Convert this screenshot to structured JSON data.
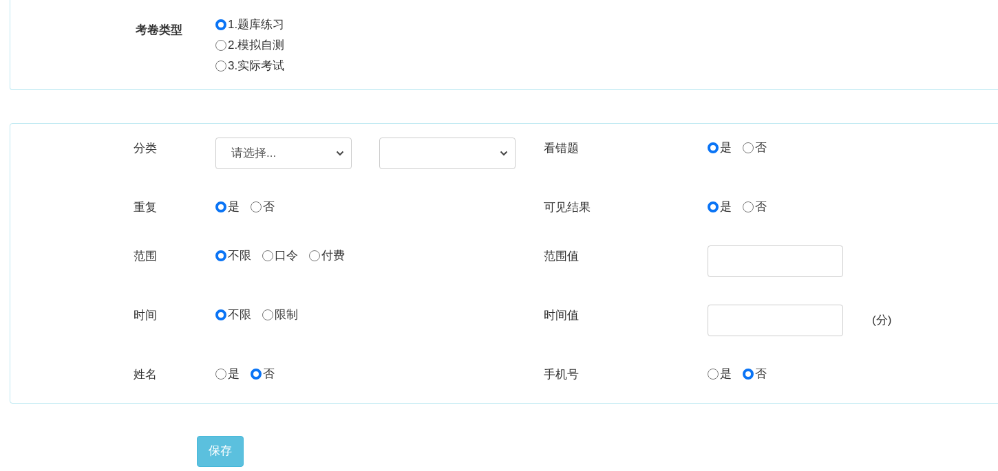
{
  "exam_type": {
    "label": "考卷类型",
    "options": [
      {
        "label": "1.题库练习",
        "selected": true
      },
      {
        "label": "2.模拟自测",
        "selected": false
      },
      {
        "label": "3.实际考试",
        "selected": false
      }
    ]
  },
  "settings": [
    {
      "fields": [
        {
          "label": "分类",
          "kind": "selects",
          "selects": [
            {
              "kind": "filled",
              "value": "请选择..."
            },
            {
              "kind": "blank"
            }
          ]
        },
        {
          "label": "看错题",
          "kind": "radios",
          "options": [
            {
              "label": "是",
              "selected": true
            },
            {
              "label": "否",
              "selected": false
            }
          ]
        }
      ]
    },
    {
      "fields": [
        {
          "label": "重复",
          "kind": "radios",
          "options": [
            {
              "label": "是",
              "selected": true
            },
            {
              "label": "否",
              "selected": false
            }
          ]
        },
        {
          "label": "可见结果",
          "kind": "radios",
          "options": [
            {
              "label": "是",
              "selected": true
            },
            {
              "label": "否",
              "selected": false
            }
          ]
        }
      ]
    },
    {
      "fields": [
        {
          "label": "范围",
          "kind": "radios",
          "options": [
            {
              "label": "不限",
              "selected": true
            },
            {
              "label": "口令",
              "selected": false
            },
            {
              "label": "付费",
              "selected": false
            }
          ]
        },
        {
          "label": "范围值",
          "kind": "input"
        }
      ]
    },
    {
      "fields": [
        {
          "label": "时间",
          "kind": "radios",
          "options": [
            {
              "label": "不限",
              "selected": true
            },
            {
              "label": "限制",
              "selected": false
            }
          ]
        },
        {
          "label": "时间值",
          "kind": "input",
          "unit": "(分)"
        }
      ]
    },
    {
      "fields": [
        {
          "label": "姓名",
          "kind": "radios",
          "options": [
            {
              "label": "是",
              "selected": false
            },
            {
              "label": "否",
              "selected": true
            }
          ]
        },
        {
          "label": "手机号",
          "kind": "radios",
          "options": [
            {
              "label": "是",
              "selected": false
            },
            {
              "label": "否",
              "selected": true
            }
          ]
        }
      ]
    }
  ],
  "save_button": "保存"
}
